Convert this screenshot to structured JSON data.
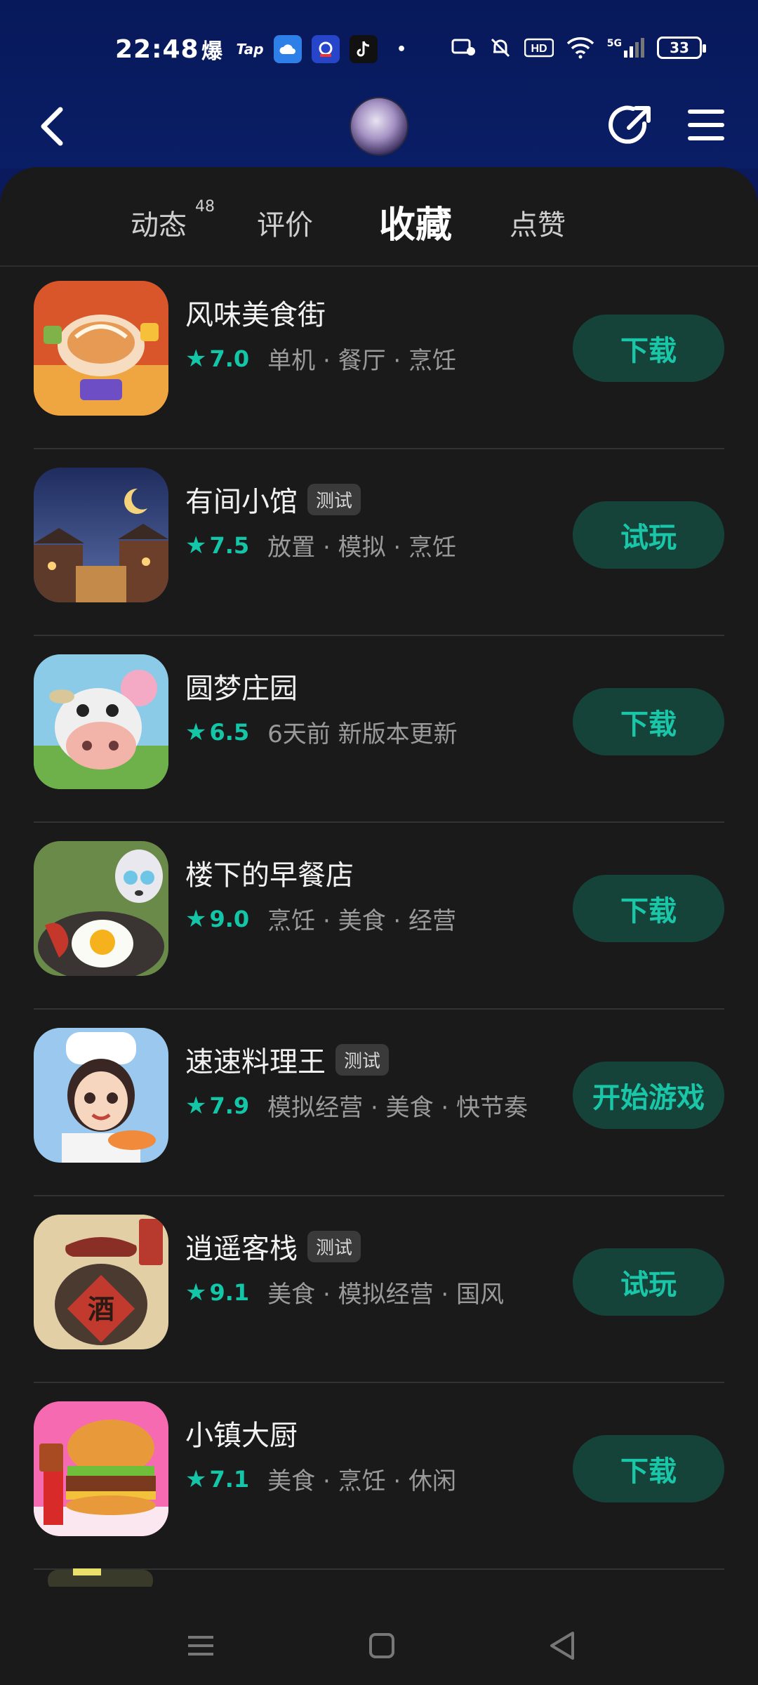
{
  "status_bar": {
    "time": "22:48",
    "left_icons": [
      "爆",
      "Tap"
    ],
    "battery": "33",
    "network": "5G"
  },
  "header": {
    "icons": [
      "back-icon",
      "avatar",
      "share-icon",
      "menu-icon"
    ]
  },
  "tabs": [
    {
      "label": "动态",
      "badge": "48",
      "active": false
    },
    {
      "label": "评价",
      "active": false
    },
    {
      "label": "收藏",
      "active": true
    },
    {
      "label": "点赞",
      "active": false
    }
  ],
  "apps": [
    {
      "name": "风味美食街",
      "badge": "",
      "rating": "7.0",
      "meta": "单机 · 餐厅 · 烹饪",
      "action": "下载"
    },
    {
      "name": "有间小馆",
      "badge": "测试",
      "rating": "7.5",
      "meta": "放置 · 模拟 · 烹饪",
      "action": "试玩"
    },
    {
      "name": "圆梦庄园",
      "badge": "",
      "rating": "6.5",
      "meta": "6天前 新版本更新",
      "action": "下载"
    },
    {
      "name": "楼下的早餐店",
      "badge": "",
      "rating": "9.0",
      "meta": "烹饪 · 美食 · 经营",
      "action": "下载"
    },
    {
      "name": "速速料理王",
      "badge": "测试",
      "rating": "7.9",
      "meta": "模拟经营 · 美食 · 快节奏",
      "action": "开始游戏"
    },
    {
      "name": "逍遥客栈",
      "badge": "测试",
      "rating": "9.1",
      "meta": "美食 · 模拟经营 · 国风",
      "action": "试玩"
    },
    {
      "name": "小镇大厨",
      "badge": "",
      "rating": "7.1",
      "meta": "美食 · 烹饪 · 休闲",
      "action": "下载"
    }
  ],
  "colors": {
    "accent": "#14c6a8",
    "button_bg": "#15433a",
    "panel_bg": "#1a1a1a",
    "header_bg": "#07195a"
  }
}
